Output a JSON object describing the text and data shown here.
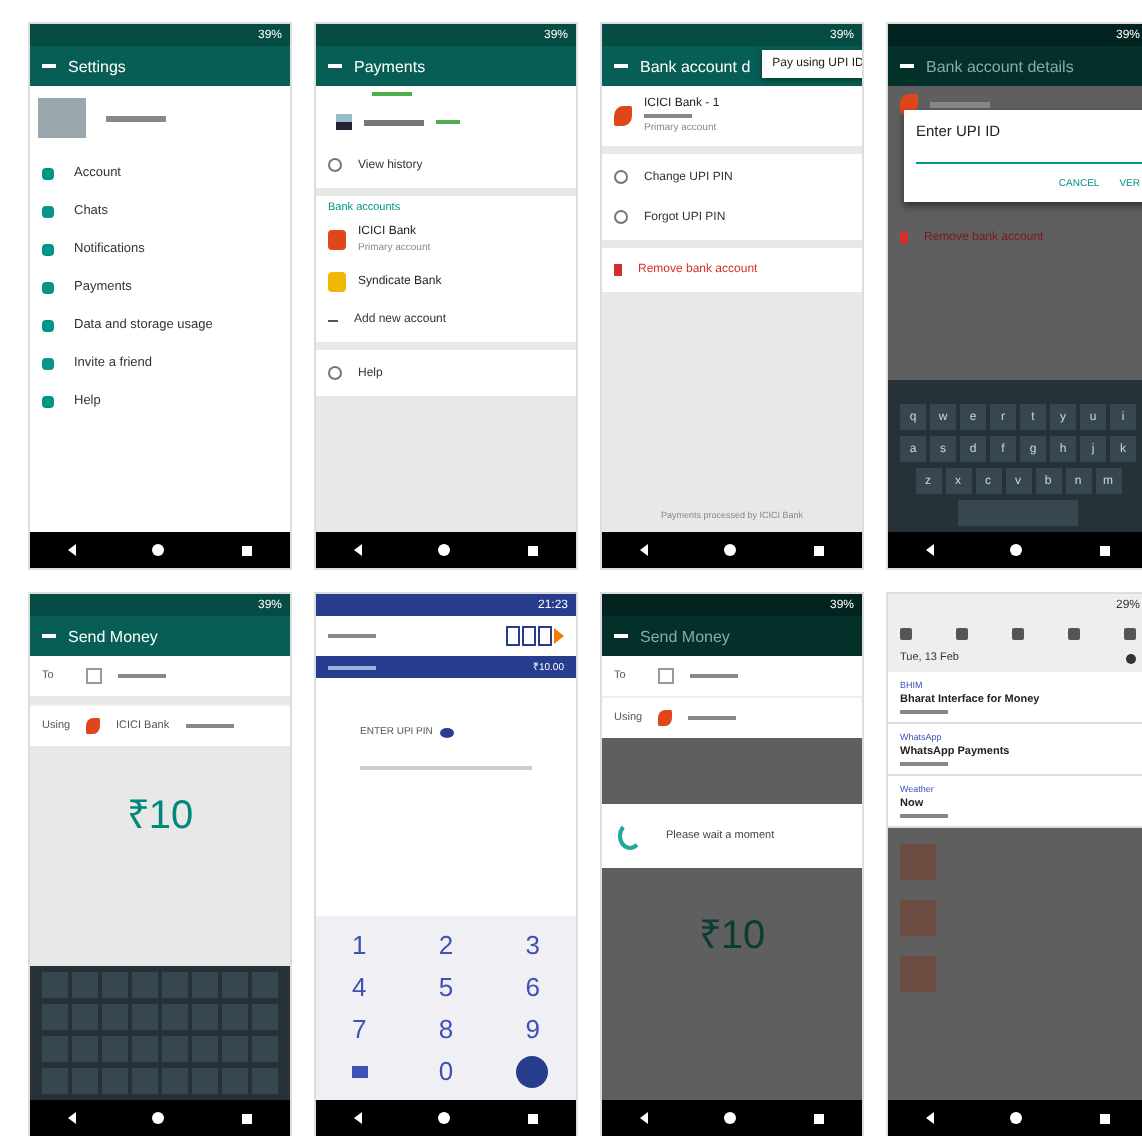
{
  "phones": [
    {
      "kind": "settings",
      "status": "39%",
      "title": "Settings",
      "items": [
        {
          "label": "Account"
        },
        {
          "label": "Chats"
        },
        {
          "label": "Notifications"
        },
        {
          "label": "Payments"
        },
        {
          "label": "Data and storage usage"
        },
        {
          "label": "Invite a friend"
        },
        {
          "label": "Help"
        }
      ]
    },
    {
      "kind": "payments",
      "status": "39%",
      "title": "Payments",
      "history": "View history",
      "section": "Bank accounts",
      "banks": [
        {
          "name": "ICICI Bank",
          "detail": "Primary account",
          "color": "#e0461b"
        },
        {
          "name": "Syndicate Bank",
          "color": "#f2b705"
        }
      ],
      "add": "Add new account",
      "help": "Help"
    },
    {
      "kind": "bank_details",
      "status": "39%",
      "title": "Bank account d",
      "menu": "Pay using UPI ID",
      "bank": "ICICI Bank - 1",
      "detail": "Primary account",
      "actions": [
        "Change UPI PIN",
        "Forgot UPI PIN"
      ],
      "remove": "Remove bank account",
      "footer": "Payments processed by ICICI Bank"
    },
    {
      "kind": "upi_dialog",
      "status": "39%",
      "title": "Bank account details",
      "dialog_title": "Enter UPI ID",
      "buttons": [
        "CANCEL",
        "VER"
      ],
      "remove": "Remove bank account",
      "keys": [
        [
          "q",
          "w",
          "e",
          "r",
          "t",
          "y",
          "u",
          "i"
        ],
        [
          "a",
          "s",
          "d",
          "f",
          "g",
          "h",
          "j",
          "k"
        ],
        [
          "z",
          "x",
          "c",
          "v",
          "b",
          "n",
          "m"
        ]
      ]
    },
    {
      "kind": "send_money",
      "status": "39%",
      "title": "Send Money",
      "to_label": "To",
      "using_label": "Using",
      "bank": "ICICI Bank",
      "amount": "₹10"
    },
    {
      "kind": "upi_pin",
      "status": "21:23",
      "amount": "₹10.00",
      "prompt": "ENTER UPI PIN",
      "digits": [
        "1",
        "2",
        "3",
        "4",
        "5",
        "6",
        "7",
        "8",
        "9",
        "0"
      ]
    },
    {
      "kind": "wait",
      "status": "39%",
      "title": "Send Money",
      "to_label": "To",
      "using_label": "Using",
      "message": "Please wait a moment",
      "amount": "₹10"
    },
    {
      "kind": "notifications",
      "status": "29%",
      "date": "Tue, 13 Feb",
      "notes": [
        {
          "app": "BHIM",
          "title": "Bharat Interface for Money"
        },
        {
          "app": "WhatsApp",
          "title": "WhatsApp Payments"
        },
        {
          "app": "Weather",
          "title": "Now"
        }
      ]
    }
  ]
}
